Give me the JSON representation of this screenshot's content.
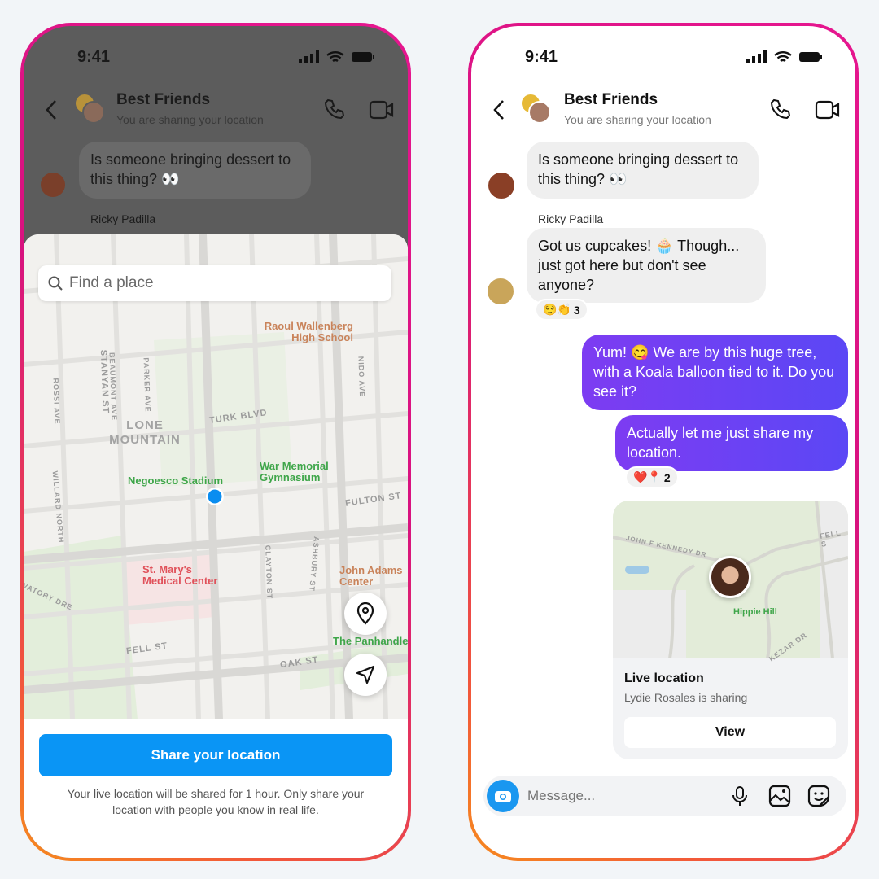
{
  "status": {
    "time": "9:41"
  },
  "header": {
    "title": "Best Friends",
    "subtitle": "You are sharing your location"
  },
  "messages": [
    {
      "text": "Is someone bringing dessert to this thing? 👀"
    },
    {
      "sender": "Ricky Padilla",
      "text": "Got us cupcakes! 🧁 Though... just got here but don't see anyone?",
      "reactions": "😌👏",
      "reaction_count": "3"
    },
    {
      "text": "Yum! 😋 We are by this huge tree, with a Koala balloon tied to it. Do you see it?"
    },
    {
      "text": "Actually let me just share my location.",
      "reactions": "❤️📍",
      "reaction_count": "2"
    }
  ],
  "location_card": {
    "title": "Live location",
    "subtitle": "Lydie Rosales is sharing",
    "view_label": "View",
    "map_labels": [
      "JOHN F KENNEDY DR",
      "FELL S",
      "KEZAR DR",
      "Hippie Hill"
    ]
  },
  "composer": {
    "placeholder": "Message..."
  },
  "left_sheet": {
    "search_placeholder": "Find a place",
    "share_label": "Share your location",
    "note": "Your live location will be shared for 1 hour. Only share your location with people you know in real life.",
    "map": {
      "streets": [
        "STANYAN ST",
        "BEAUMONT AVE",
        "PARKER AVE",
        "ROSSI AVE",
        "WILLARD NORTH",
        "TURK BLVD",
        "FULTON ST",
        "CLAYTON ST",
        "ASHBURY ST",
        "FELL ST",
        "OAK ST",
        "NIDO AVE",
        "VATORY DRE"
      ],
      "area": "LONE MOUNTAIN",
      "pois": [
        {
          "name": "Raoul Wallenberg High School",
          "color": "#c9835a"
        },
        {
          "name": "Negoesco Stadium",
          "color": "#3fa64a"
        },
        {
          "name": "War Memorial Gymnasium",
          "color": "#3fa64a"
        },
        {
          "name": "St. Mary's Medical Center",
          "color": "#e0515a"
        },
        {
          "name": "John Adams Center",
          "color": "#c9835a"
        },
        {
          "name": "The Panhandle",
          "color": "#3fa64a"
        }
      ]
    }
  },
  "colors": {
    "primary_blue": "#0a95f5",
    "purple_start": "#7d3cf2",
    "purple_end": "#5b47f5"
  }
}
